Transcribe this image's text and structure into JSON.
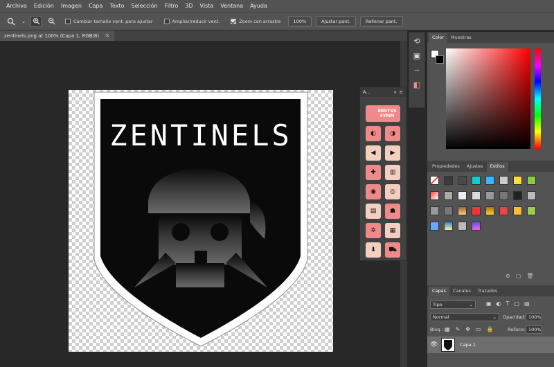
{
  "menu": [
    "Archivo",
    "Edición",
    "Imagen",
    "Capa",
    "Texto",
    "Selección",
    "Filtro",
    "3D",
    "Vista",
    "Ventana",
    "Ayuda"
  ],
  "options": {
    "resize_windows": "Cambiar tamaño vent. para ajustar",
    "zoom_all": "Ampliar/reducir vent.",
    "scrubby_zoom": "Zoom con arrastre",
    "zoom_value": "100%",
    "fit_screen": "Ajustar pant.",
    "fill_screen": "Rellenar pant."
  },
  "document": {
    "tab_title": "zentinels.png at 100% (Capa 1, RGB/8)",
    "close": "×"
  },
  "artwork": {
    "title": "ZENTINELS"
  },
  "floating_panel": {
    "title": "A...",
    "collapse": "»",
    "menu": "≡",
    "top_icon_text": "BRUTUS 5YMM"
  },
  "color_panel": {
    "tabs": [
      "Color",
      "Muestras"
    ],
    "active": "Color"
  },
  "styles_panel": {
    "tabs": [
      "Propiedades",
      "Ajustes",
      "Estilos"
    ],
    "active": "Estilos"
  },
  "layers_panel": {
    "tabs": [
      "Capas",
      "Canales",
      "Trazados"
    ],
    "active": "Capas",
    "filter": "Tipo",
    "blend_mode": "Normal",
    "opacity_label": "Opacidad:",
    "opacity": "100%",
    "lock_label": "Bloq.:",
    "fill_label": "Relleno:",
    "fill": "100%",
    "layer_name": "Capa 1"
  },
  "colors": {
    "accent": "#f08a8a",
    "ui": "#535353",
    "dark": "#282828"
  }
}
